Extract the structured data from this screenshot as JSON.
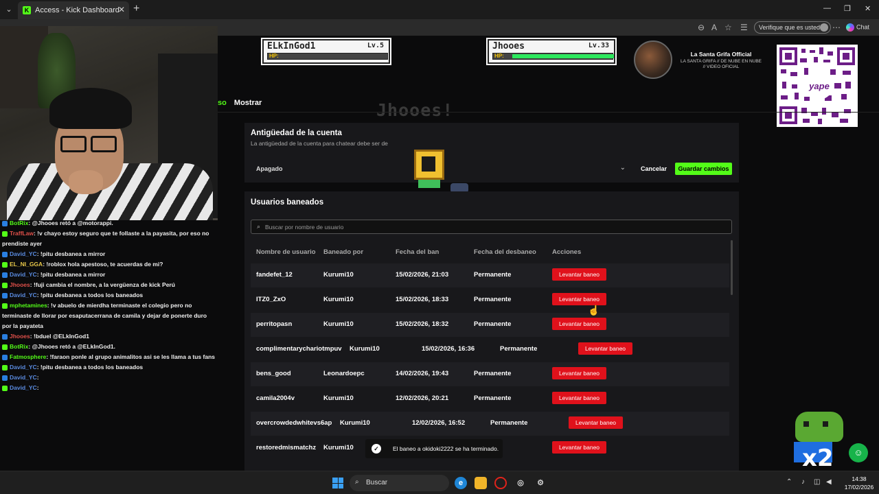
{
  "browser": {
    "tab_title": "Access - Kick Dashboard",
    "tab_favicon": "K",
    "verify_label": "Verifique que es usted",
    "chat_label": "Chat"
  },
  "overlay": {
    "player1": {
      "name": "ELkInGod1",
      "level": "Lv.5",
      "hp_label": "HP:",
      "hp_fraction": 0.0
    },
    "player2": {
      "name": "Jhooes",
      "level": "Lv.33",
      "hp_label": "HP:",
      "hp_fraction": 1.0
    },
    "channel_name": "La Santa Grifa Official",
    "channel_sub": "LA SANTA GRIFA // DE NUBE EN NUBE // VIDEO OFICIAL",
    "qr_text": "yape",
    "big_name": "Jhooes!",
    "mascot_text": "x2"
  },
  "chat": [
    {
      "user": "BotRix",
      "user_color": "#53fc18",
      "text": ": @Jhooes retó a @motorappi."
    },
    {
      "user": "TraffLaw",
      "user_color": "#e0504a",
      "text": ": !v chayo estoy seguro que te follaste a la payasita, por eso no prendiste ayer"
    },
    {
      "user": "David_YC",
      "user_color": "#5a8be0",
      "text": ": !pitu desbanea a mirror"
    },
    {
      "user": "EL_NI_GGA",
      "user_color": "#e8c84a",
      "text": ": !roblox hola apestoso, te acuerdas de mi?"
    },
    {
      "user": "David_YC",
      "user_color": "#5a8be0",
      "text": ": !pitu desbanea a mirror"
    },
    {
      "user": "Jhooes",
      "user_color": "#e0504a",
      "text": ": !fuji cambia el nombre, a la vergüenza de kick Perú"
    },
    {
      "user": "David_YC",
      "user_color": "#5a8be0",
      "text": ": !pitu desbanea a todos los baneados"
    },
    {
      "user": "mphetamines",
      "user_color": "#53fc18",
      "text": ": !v abuelo de mierdha terminaste el colegio pero no terminaste de llorar por esaputacerrana de camila y dejar de ponerte duro por la payateta"
    },
    {
      "user": "Jhooes",
      "user_color": "#e0504a",
      "text": ": !bduel @ELkInGod1"
    },
    {
      "user": "BotRix",
      "user_color": "#53fc18",
      "text": ": @Jhooes retó a @ELkInGod1."
    },
    {
      "user": "Fatmosphere",
      "user_color": "#53fc18",
      "text": ": !faraon ponle al grupo animalitos asi se les llama a tus fans"
    },
    {
      "user": "David_YC",
      "user_color": "#5a8be0",
      "text": ": !pitu desbanea a todos los baneados"
    },
    {
      "user": "David_YC",
      "user_color": "#5a8be0",
      "text": ":"
    },
    {
      "user": "David_YC",
      "user_color": "#5a8be0",
      "text": ":"
    }
  ],
  "nav": {
    "tab_partial": "so",
    "tab_show": "Mostrar"
  },
  "account_age": {
    "title": "Antigüedad de la cuenta",
    "subtitle": "La antigüedad de la cuenta para chatear debe ser de",
    "select_value": "Apagado",
    "cancel_label": "Cancelar",
    "save_label": "Guardar cambios"
  },
  "banned": {
    "title": "Usuarios baneados",
    "search_placeholder": "Buscar por nombre de usuario",
    "columns": [
      "Nombre de usuario",
      "Baneado por",
      "Fecha del ban",
      "Fecha del desbaneo",
      "Acciones"
    ],
    "action_label": "Levantar baneo",
    "rows": [
      [
        "fandefet_12",
        "Kurumi10",
        "15/02/2026, 21:03",
        "Permanente"
      ],
      [
        "ITZ0_ZxO",
        "Kurumi10",
        "15/02/2026, 18:33",
        "Permanente"
      ],
      [
        "perritopasn",
        "Kurumi10",
        "15/02/2026, 18:32",
        "Permanente"
      ],
      [
        "complimentarychariotmpuv",
        "Kurumi10",
        "15/02/2026, 16:36",
        "Permanente"
      ],
      [
        "bens_good",
        "Leonardoepc",
        "14/02/2026, 19:43",
        "Permanente"
      ],
      [
        "camila2004v",
        "Kurumi10",
        "12/02/2026, 20:21",
        "Permanente"
      ],
      [
        "overcrowdedwhitevs6ap",
        "Kurumi10",
        "12/02/2026, 16:52",
        "Permanente"
      ],
      [
        "restoredmismatchz",
        "Kurumi10",
        "",
        ""
      ]
    ]
  },
  "toast": {
    "text": "El baneo a okidoki2222 se ha terminado."
  },
  "taskbar": {
    "search_label": "Buscar",
    "time": "14:38",
    "date": "17/02/2026"
  },
  "colors": {
    "accent": "#53fc18",
    "danger": "#e0111b",
    "panel": "#18181b"
  }
}
